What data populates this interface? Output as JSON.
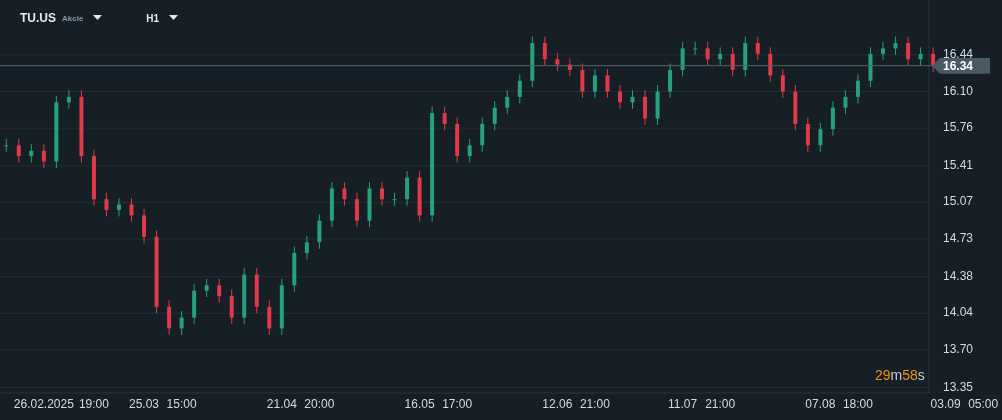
{
  "header": {
    "symbol": "TU.US",
    "asset_type": "Akcie",
    "timeframe": "H1"
  },
  "chart": {
    "chart_data": {
      "type": "candlestick",
      "grid": true,
      "ylim": [
        13.3,
        16.95
      ],
      "yticks": [
        {
          "value": 16.44,
          "label": "16.44"
        },
        {
          "value": 16.1,
          "label": "16.10"
        },
        {
          "value": 15.76,
          "label": "15.76"
        },
        {
          "value": 15.41,
          "label": "15.41"
        },
        {
          "value": 15.07,
          "label": "15.07"
        },
        {
          "value": 14.73,
          "label": "14.73"
        },
        {
          "value": 14.38,
          "label": "14.38"
        },
        {
          "value": 14.04,
          "label": "14.04"
        },
        {
          "value": 13.7,
          "label": "13.70"
        },
        {
          "value": 13.35,
          "label": "13.35"
        }
      ],
      "categories": [
        null,
        null,
        null,
        "26.02.2025",
        null,
        null,
        null,
        "19:00",
        null,
        null,
        null,
        "25.03",
        null,
        null,
        "15:00",
        null,
        null,
        null,
        null,
        null,
        null,
        null,
        "21.04",
        null,
        null,
        "20:00",
        null,
        null,
        null,
        null,
        null,
        null,
        null,
        "16.05",
        null,
        null,
        "17:00",
        null,
        null,
        null,
        null,
        null,
        null,
        null,
        "12.06",
        null,
        null,
        "21:00",
        null,
        null,
        null,
        null,
        null,
        null,
        "11.07",
        null,
        null,
        "21:00",
        null,
        null,
        null,
        null,
        null,
        null,
        null,
        "07.08",
        null,
        null,
        "18:00",
        null,
        null,
        null,
        null,
        null,
        null,
        "03.09",
        null,
        null,
        "05:00",
        null
      ],
      "ohlc": [
        [
          15.6,
          15.66,
          15.54,
          15.6
        ],
        [
          15.6,
          15.66,
          15.44,
          15.5
        ],
        [
          15.5,
          15.61,
          15.44,
          15.55
        ],
        [
          15.55,
          15.61,
          15.39,
          15.45
        ],
        [
          15.45,
          16.06,
          15.39,
          16.0
        ],
        [
          16.0,
          16.11,
          15.94,
          16.05
        ],
        [
          16.05,
          16.11,
          15.44,
          15.5
        ],
        [
          15.5,
          15.56,
          15.04,
          15.1
        ],
        [
          15.1,
          15.16,
          14.94,
          15.0
        ],
        [
          15.0,
          15.11,
          14.94,
          15.05
        ],
        [
          15.05,
          15.11,
          14.89,
          14.95
        ],
        [
          14.95,
          15.01,
          14.69,
          14.75
        ],
        [
          14.75,
          14.81,
          14.04,
          14.1
        ],
        [
          14.1,
          14.16,
          13.84,
          13.9
        ],
        [
          13.9,
          14.06,
          13.84,
          14.0
        ],
        [
          14.0,
          14.31,
          13.94,
          14.25
        ],
        [
          14.25,
          14.36,
          14.19,
          14.3
        ],
        [
          14.3,
          14.36,
          14.14,
          14.2
        ],
        [
          14.2,
          14.26,
          13.94,
          14.0
        ],
        [
          14.0,
          14.46,
          13.94,
          14.4
        ],
        [
          14.4,
          14.46,
          14.04,
          14.1
        ],
        [
          14.1,
          14.16,
          13.84,
          13.9
        ],
        [
          13.9,
          14.36,
          13.84,
          14.3
        ],
        [
          14.3,
          14.66,
          14.24,
          14.6
        ],
        [
          14.6,
          14.76,
          14.54,
          14.7
        ],
        [
          14.7,
          14.96,
          14.64,
          14.9
        ],
        [
          14.9,
          15.26,
          14.84,
          15.2
        ],
        [
          15.2,
          15.26,
          15.04,
          15.1
        ],
        [
          15.1,
          15.16,
          14.84,
          14.9
        ],
        [
          14.9,
          15.26,
          14.84,
          15.2
        ],
        [
          15.2,
          15.26,
          15.04,
          15.1
        ],
        [
          15.1,
          15.16,
          15.04,
          15.1
        ],
        [
          15.1,
          15.36,
          15.04,
          15.3
        ],
        [
          15.3,
          15.36,
          14.89,
          14.95
        ],
        [
          14.95,
          15.96,
          14.89,
          15.9
        ],
        [
          15.9,
          15.96,
          15.74,
          15.8
        ],
        [
          15.8,
          15.86,
          15.44,
          15.5
        ],
        [
          15.5,
          15.66,
          15.44,
          15.6
        ],
        [
          15.6,
          15.86,
          15.54,
          15.8
        ],
        [
          15.8,
          16.01,
          15.74,
          15.95
        ],
        [
          15.95,
          16.11,
          15.89,
          16.05
        ],
        [
          16.05,
          16.26,
          15.99,
          16.2
        ],
        [
          16.2,
          16.61,
          16.14,
          16.55
        ],
        [
          16.55,
          16.61,
          16.34,
          16.4
        ],
        [
          16.4,
          16.46,
          16.29,
          16.35
        ],
        [
          16.35,
          16.41,
          16.24,
          16.3
        ],
        [
          16.3,
          16.36,
          16.04,
          16.1
        ],
        [
          16.1,
          16.31,
          16.04,
          16.25
        ],
        [
          16.25,
          16.31,
          16.04,
          16.1
        ],
        [
          16.1,
          16.16,
          15.94,
          16.0
        ],
        [
          16.0,
          16.11,
          15.94,
          16.05
        ],
        [
          16.05,
          16.11,
          15.79,
          15.85
        ],
        [
          15.85,
          16.16,
          15.79,
          16.1
        ],
        [
          16.1,
          16.36,
          16.04,
          16.3
        ],
        [
          16.3,
          16.56,
          16.24,
          16.5
        ],
        [
          16.5,
          16.56,
          16.44,
          16.5
        ],
        [
          16.5,
          16.56,
          16.34,
          16.4
        ],
        [
          16.4,
          16.51,
          16.34,
          16.45
        ],
        [
          16.45,
          16.51,
          16.24,
          16.3
        ],
        [
          16.3,
          16.61,
          16.24,
          16.55
        ],
        [
          16.55,
          16.61,
          16.39,
          16.45
        ],
        [
          16.45,
          16.51,
          16.19,
          16.25
        ],
        [
          16.25,
          16.31,
          16.04,
          16.1
        ],
        [
          16.1,
          16.16,
          15.74,
          15.8
        ],
        [
          15.8,
          15.86,
          15.54,
          15.6
        ],
        [
          15.6,
          15.81,
          15.54,
          15.75
        ],
        [
          15.75,
          16.01,
          15.69,
          15.95
        ],
        [
          15.95,
          16.11,
          15.89,
          16.05
        ],
        [
          16.05,
          16.26,
          15.99,
          16.2
        ],
        [
          16.2,
          16.51,
          16.14,
          16.45
        ],
        [
          16.45,
          16.56,
          16.39,
          16.5
        ],
        [
          16.5,
          16.61,
          16.44,
          16.55
        ],
        [
          16.55,
          16.61,
          16.34,
          16.4
        ],
        [
          16.4,
          16.51,
          16.34,
          16.45
        ],
        [
          16.45,
          16.51,
          16.28,
          16.34
        ],
        null,
        null,
        null,
        null,
        null
      ],
      "ref_lines": [
        {
          "axis": "y",
          "value": 16.34,
          "label": "16.34"
        }
      ]
    }
  },
  "countdown": [
    {
      "kind": "number",
      "text": "29"
    },
    {
      "kind": "unit",
      "text": "m"
    },
    {
      "kind": "number",
      "text": "58"
    },
    {
      "kind": "unit",
      "text": "s"
    }
  ]
}
